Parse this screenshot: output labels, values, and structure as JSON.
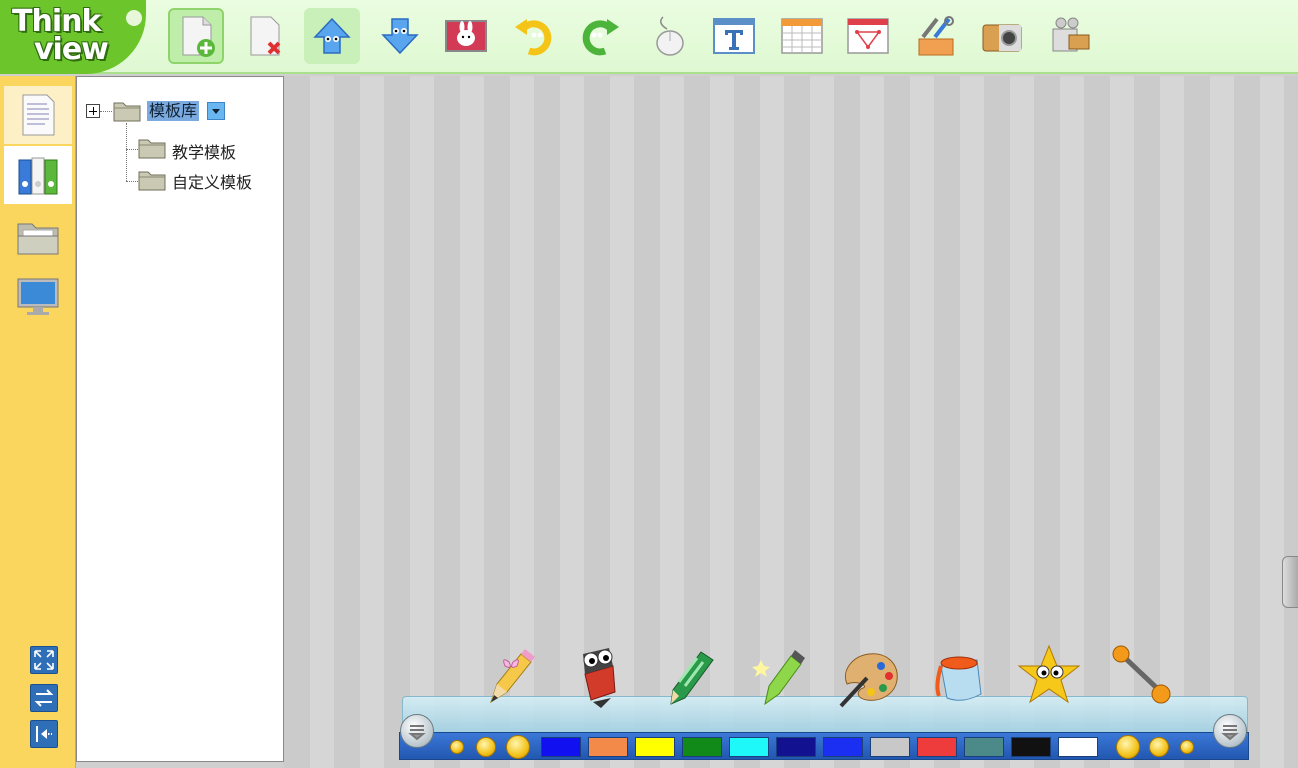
{
  "app": {
    "logo_line1": "Think",
    "logo_line2": "view"
  },
  "toolbar": {
    "buttons": [
      {
        "name": "new-page",
        "icon": "new-page-icon"
      },
      {
        "name": "delete-page",
        "icon": "delete-page-icon"
      },
      {
        "name": "previous-page",
        "icon": "arrow-up-icon"
      },
      {
        "name": "next-page",
        "icon": "arrow-down-icon"
      },
      {
        "name": "background",
        "icon": "picture-frame-icon"
      },
      {
        "name": "undo",
        "icon": "undo-icon"
      },
      {
        "name": "redo",
        "icon": "redo-icon"
      },
      {
        "name": "mouse",
        "icon": "mouse-icon"
      },
      {
        "name": "text",
        "icon": "text-icon"
      },
      {
        "name": "table",
        "icon": "table-icon"
      },
      {
        "name": "shape",
        "icon": "shape-icon"
      },
      {
        "name": "tools",
        "icon": "toolbox-icon"
      },
      {
        "name": "camera",
        "icon": "camera-icon"
      },
      {
        "name": "video",
        "icon": "video-camera-icon"
      }
    ]
  },
  "sidebar": {
    "items": [
      {
        "name": "pages",
        "icon": "document-icon"
      },
      {
        "name": "templates",
        "icon": "binders-icon"
      },
      {
        "name": "resources",
        "icon": "folder-icon"
      },
      {
        "name": "screen",
        "icon": "monitor-icon"
      }
    ],
    "bottom_buttons": [
      {
        "name": "fullscreen",
        "icon": "expand-icon"
      },
      {
        "name": "switch",
        "icon": "swap-icon"
      },
      {
        "name": "collapse",
        "icon": "collapse-left-icon"
      }
    ]
  },
  "tree": {
    "root": {
      "label": "模板库"
    },
    "children": [
      {
        "label": "教学模板"
      },
      {
        "label": "自定义模板"
      }
    ]
  },
  "tray": {
    "tools": [
      {
        "name": "pencil",
        "icon": "pencil-icon"
      },
      {
        "name": "marker",
        "icon": "marker-icon"
      },
      {
        "name": "crayon",
        "icon": "crayon-icon"
      },
      {
        "name": "highlighter",
        "icon": "highlighter-icon"
      },
      {
        "name": "palette",
        "icon": "palette-icon"
      },
      {
        "name": "fill-bucket",
        "icon": "bucket-icon"
      },
      {
        "name": "magic-star",
        "icon": "star-icon"
      },
      {
        "name": "line",
        "icon": "line-icon"
      }
    ],
    "colors": [
      "#1010f0",
      "#f48a4a",
      "#ffff00",
      "#118a1a",
      "#1ff8f8",
      "#121290",
      "#1a2ff2",
      "#c8c8c8",
      "#ee3b3b",
      "#4c8a8a",
      "#111111",
      "#ffffff"
    ]
  }
}
